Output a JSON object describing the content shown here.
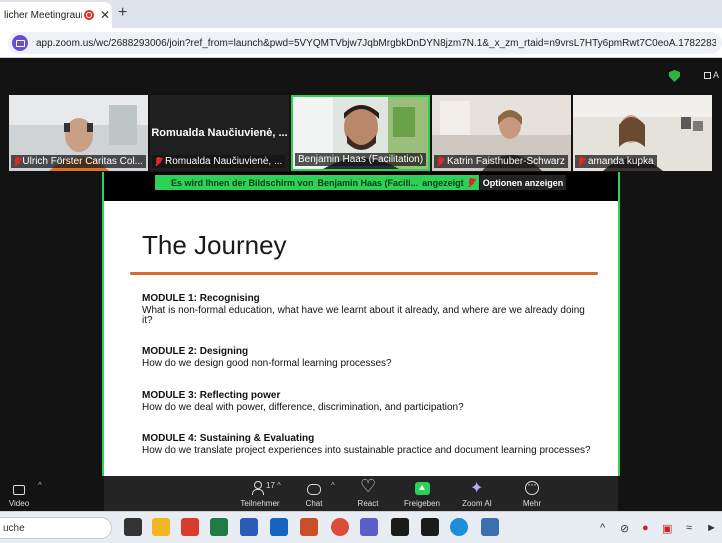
{
  "browser": {
    "tab_title": "licher Meetingraum",
    "tab_close": "✕",
    "new_tab": "+",
    "url": "app.zoom.us/wc/2688293006/join?ref_from=launch&pwd=5VYQMTVbjw7JqbMrgbkDnDYN8jzm7N.1&_x_zm_rtaid=n9vrsL7HTy6pmRwt7C0eoA.178228357170..."
  },
  "zoom_top": {
    "view_label": "A"
  },
  "participants": [
    {
      "name": "Ulrich Förster Caritas Col...",
      "muted": true,
      "video": true,
      "speaking": false
    },
    {
      "name": "Romualda Naučiuvienė, ...",
      "display_name": "Romualda Naučiuvienė, ...",
      "muted": true,
      "video": false,
      "speaking": false
    },
    {
      "name": "Benjamin Haas (Facilitation)",
      "muted": false,
      "video": true,
      "speaking": true
    },
    {
      "name": "Katrin Faisthuber-Schwarz",
      "muted": true,
      "video": true,
      "speaking": false
    },
    {
      "name": "amanda kupka",
      "muted": true,
      "video": true,
      "speaking": false
    }
  ],
  "share": {
    "banner_prefix": "Es wird Ihnen der Bildschirm von",
    "banner_presenter": "Benjamin Haas (Facili...",
    "banner_suffix": "angezeigt",
    "options_button": "Optionen anzeigen"
  },
  "slide": {
    "title": "The Journey",
    "modules": [
      {
        "heading": "MODULE 1: Recognising",
        "text": "What is non-formal education, what have we learnt about it already, and where are we already doing it?"
      },
      {
        "heading": "MODULE 2: Designing",
        "text": "How do we design good non-formal learning processes?"
      },
      {
        "heading": "MODULE 3: Reflecting power",
        "text": "How do we deal with power, difference, discrimination, and participation?"
      },
      {
        "heading": "MODULE 4: Sustaining & Evaluating",
        "text": "How do we translate project experiences into sustainable practice and document learning processes?"
      }
    ]
  },
  "toolbar": {
    "video": "Video",
    "participants": "Teilnehmer",
    "participants_count": "17",
    "chat": "Chat",
    "react": "React",
    "share": "Freigeben",
    "zoom_ai": "Zoom AI",
    "more": "Mehr",
    "caret": "^"
  },
  "taskbar": {
    "search": "uche",
    "apps": [
      {
        "name": "task-view-icon",
        "color": "#333333"
      },
      {
        "name": "file-explorer-icon",
        "color": "#f2b824"
      },
      {
        "name": "acrobat-icon",
        "color": "#d83b2b"
      },
      {
        "name": "excel-icon",
        "color": "#1f7a44"
      },
      {
        "name": "word-icon",
        "color": "#2b5cb8"
      },
      {
        "name": "outlook-icon",
        "color": "#1565c0"
      },
      {
        "name": "powerpoint-icon",
        "color": "#c94f2a"
      },
      {
        "name": "chrome-icon",
        "color": "#dd4b39"
      },
      {
        "name": "teams-icon",
        "color": "#5b5fc7"
      },
      {
        "name": "app-diamond-icon",
        "color": "#1b1b1b"
      },
      {
        "name": "app-diamond-2-icon",
        "color": "#1b1b1b"
      },
      {
        "name": "edge-icon",
        "color": "#1c8fd8"
      },
      {
        "name": "desktop-icon",
        "color": "#3a6fb0"
      }
    ],
    "tray_up": "^"
  }
}
